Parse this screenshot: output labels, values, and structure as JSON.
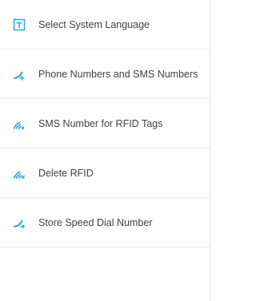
{
  "menu": {
    "items": [
      {
        "label": "Select System Language",
        "icon": "language-icon"
      },
      {
        "label": "Phone Numbers and SMS Numbers",
        "icon": "phone-plus-icon"
      },
      {
        "label": "SMS Number for RFID Tags",
        "icon": "rfid-signal-icon"
      },
      {
        "label": "Delete RFID",
        "icon": "rfid-delete-icon"
      },
      {
        "label": "Store Speed Dial Number",
        "icon": "speed-dial-icon"
      }
    ]
  },
  "colors": {
    "accent": "#29a8e0",
    "text": "#3f4347",
    "divider": "#e6e9ed",
    "background": "#ffffff"
  }
}
